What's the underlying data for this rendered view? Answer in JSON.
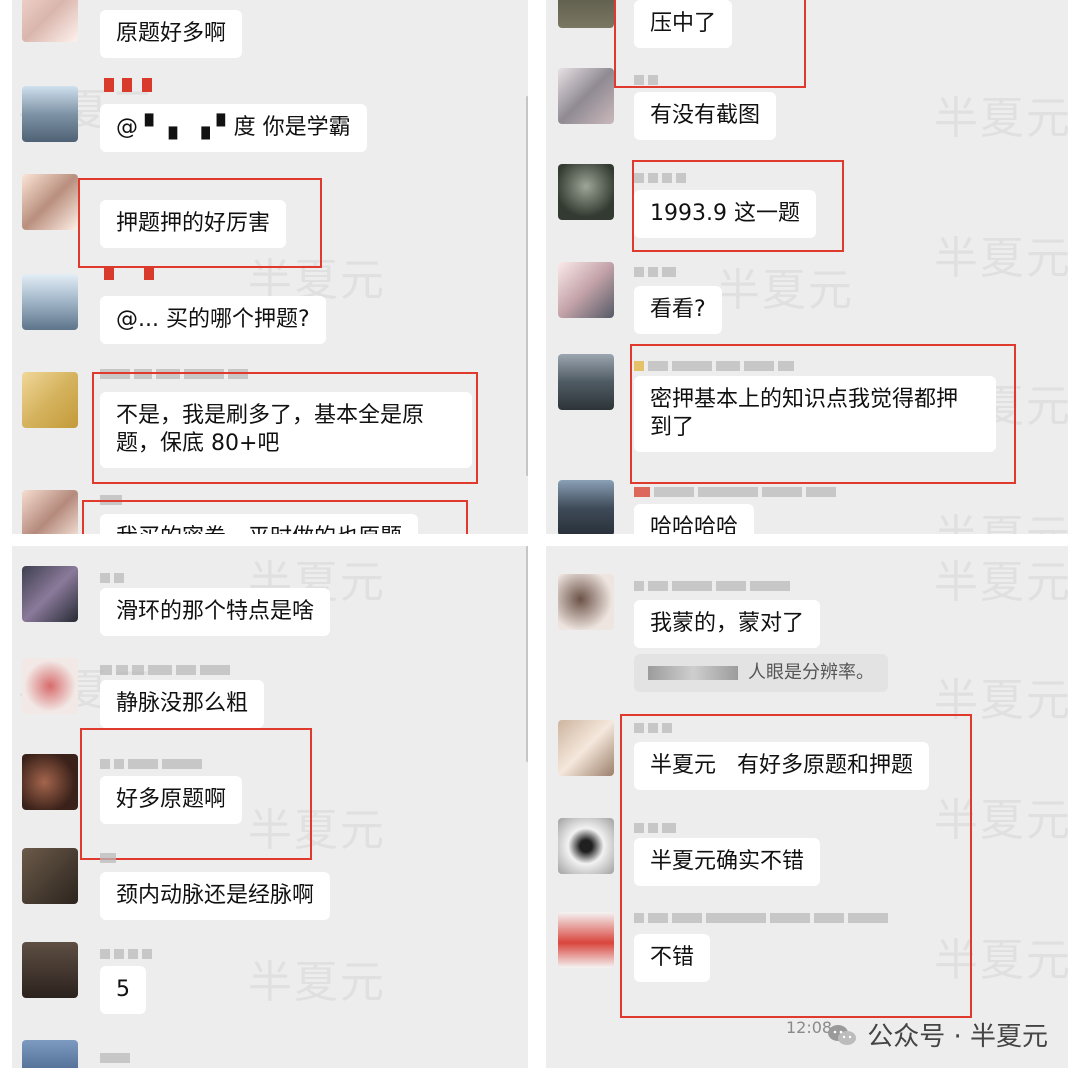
{
  "footer": {
    "account_label": "公众号 · 半夏元",
    "time": "12:08"
  },
  "watermark": "半夏元",
  "panels": {
    "top_left": {
      "messages": [
        {
          "text": "原题好多啊"
        },
        {
          "text": "@ ▘ ▖ ▗ ▘度 你是学霸"
        },
        {
          "text": "押题押的好厉害"
        },
        {
          "text": "@... 买的哪个押题?"
        },
        {
          "text": "不是，我是刷多了，基本全是原\n题，保底 80+吧"
        },
        {
          "text": "我买的密卷，平时做的也原题"
        }
      ]
    },
    "top_right": {
      "messages": [
        {
          "text": "压中了"
        },
        {
          "text": "有没有截图"
        },
        {
          "text": "1993.9 这一题"
        },
        {
          "text": "看看?"
        },
        {
          "text": "密押基本上的知识点我觉得都押\n到了"
        },
        {
          "text": "哈哈哈哈"
        }
      ]
    },
    "bottom_left": {
      "messages": [
        {
          "text": "滑环的那个特点是啥"
        },
        {
          "text": "静脉没那么粗"
        },
        {
          "text": "好多原题啊"
        },
        {
          "text": "颈内动脉还是经脉啊"
        },
        {
          "text": "5"
        }
      ]
    },
    "bottom_right": {
      "messages": [
        {
          "text": "我蒙的，蒙对了"
        },
        {
          "text": "半夏元   有好多原题和押题"
        },
        {
          "text": "半夏元确实不错"
        },
        {
          "text": "不错"
        }
      ],
      "quote": {
        "text": "人眼是分辨率。"
      }
    }
  },
  "colors": {
    "highlight": "#e0392e",
    "panel_bg": "#ededed",
    "bubble": "#ffffff"
  }
}
